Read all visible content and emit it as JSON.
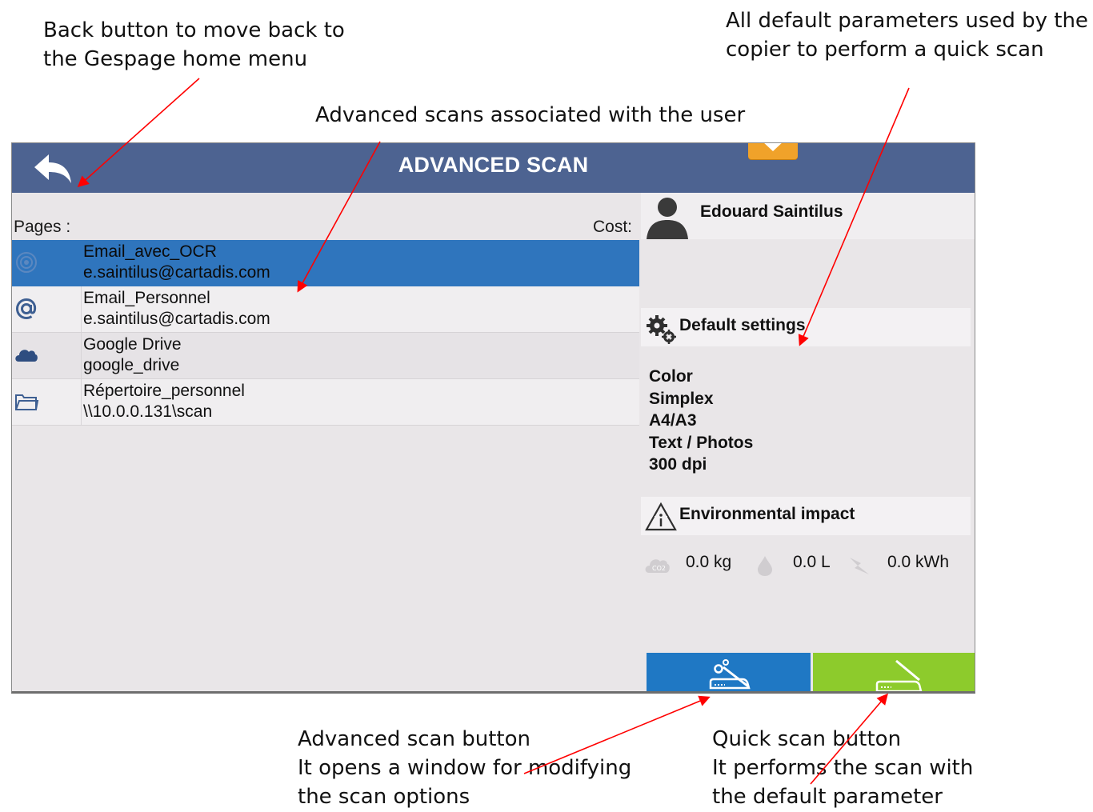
{
  "annotations": {
    "back": [
      "Back button to move back to",
      "the Gespage home menu"
    ],
    "defaults": [
      "All default parameters used by the",
      "copier to perform a quick scan"
    ],
    "advanced_scans": "Advanced scans associated with the user",
    "advanced_button": [
      "Advanced scan button",
      "It opens a window for modifying",
      "the scan options"
    ],
    "quick_button": [
      "Quick scan button",
      "It performs the scan with",
      "the default parameter"
    ]
  },
  "header": {
    "title": "ADVANCED SCAN",
    "back_icon": "back-arrow-icon",
    "menu_icon": "dropdown-tab-icon"
  },
  "list": {
    "pages_label": "Pages :",
    "cost_label": "Cost:",
    "items": [
      {
        "name": "Email_avec_OCR",
        "sub": "e.saintilus@cartadis.com",
        "icon": "email-ocr-icon"
      },
      {
        "name": "Email_Personnel",
        "sub": "e.saintilus@cartadis.com",
        "icon": "at-sign-icon"
      },
      {
        "name": "Google Drive",
        "sub": "google_drive",
        "icon": "cloud-icon"
      },
      {
        "name": "Répertoire_personnel",
        "sub": "\\\\10.0.0.131\\scan",
        "icon": "folder-icon"
      }
    ]
  },
  "user": {
    "name": "Edouard Saintilus",
    "icon": "user-avatar-icon"
  },
  "default_settings": {
    "title": "Default settings",
    "icon": "gears-icon",
    "items": [
      "Color",
      "Simplex",
      "A4/A3",
      "Text / Photos",
      "300 dpi"
    ]
  },
  "environment": {
    "title": "Environmental impact",
    "icon": "recycle-info-icon",
    "co2": "0.0 kg",
    "water": "0.0 L",
    "energy": "0.0 kWh"
  },
  "buttons": {
    "advanced": {
      "icon": "scanner-settings-icon"
    },
    "quick": {
      "icon": "scanner-icon"
    }
  },
  "colors": {
    "header": "#4d6391",
    "selected_row": "#2f75bd",
    "advanced_button": "#1f78c4",
    "quick_button": "#8dcb2c",
    "menu_tab": "#f0a22a",
    "arrow": "#ff0000"
  }
}
